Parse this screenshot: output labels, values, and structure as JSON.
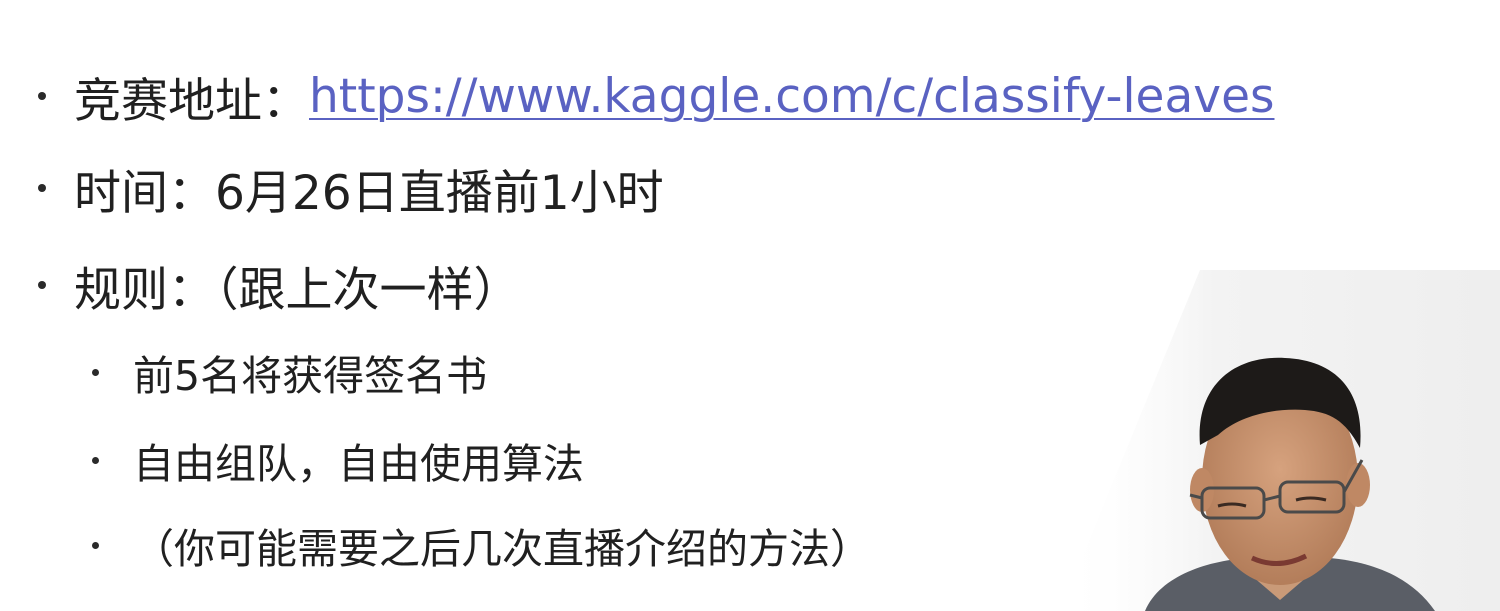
{
  "slide": {
    "items": [
      {
        "label": "竞赛地址：",
        "link_text": "https://www.kaggle.com/c/classify-leaves"
      },
      {
        "text": "时间：6月26日直播前1小时"
      },
      {
        "text": "规则：（跟上次一样）"
      }
    ],
    "sub_items": [
      {
        "text": "前5名将获得签名书"
      },
      {
        "text": "自由组队，自由使用算法"
      },
      {
        "text": "（你可能需要之后几次直播介绍的方法）"
      }
    ]
  },
  "colors": {
    "text": "#202020",
    "link": "#5a62c2",
    "background": "#ffffff"
  },
  "overlay": {
    "icon": "presenter-webcam-video"
  }
}
